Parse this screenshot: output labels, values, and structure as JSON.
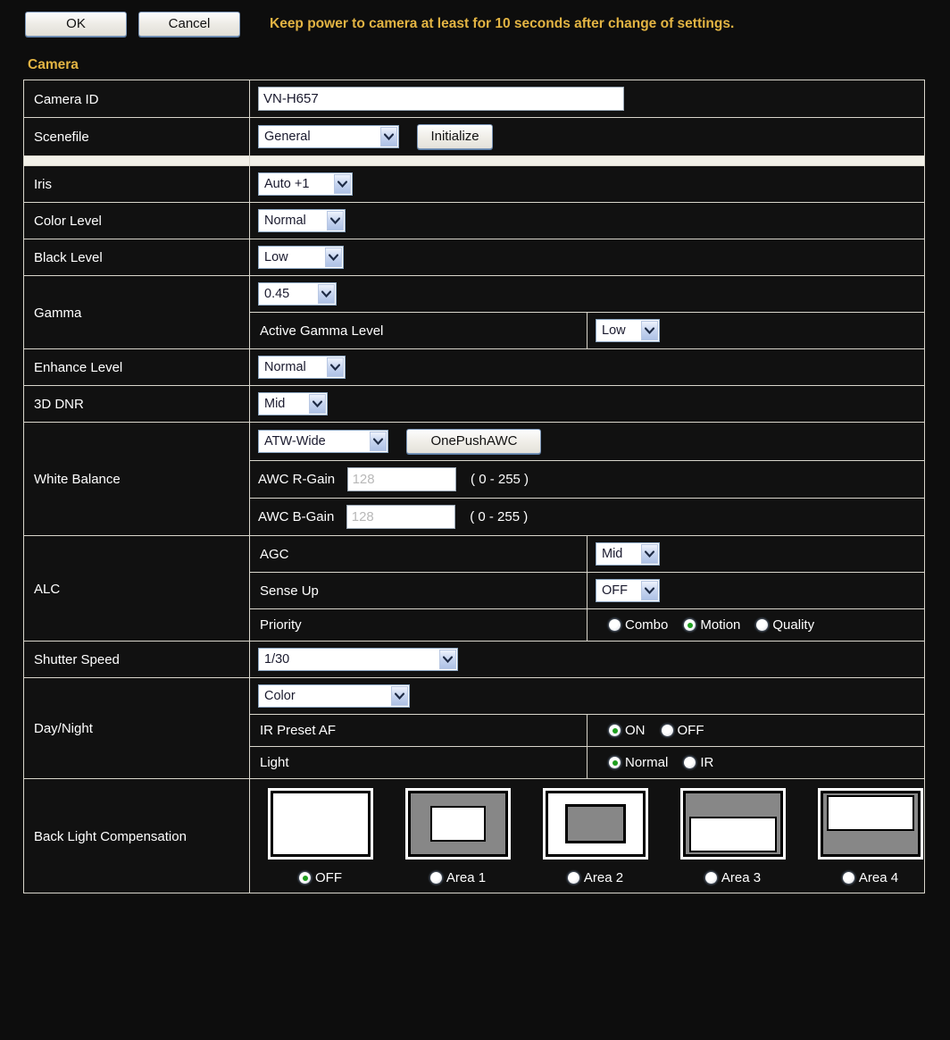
{
  "toolbar": {
    "ok_label": "OK",
    "cancel_label": "Cancel",
    "warning_text": "Keep power to camera at least for 10 seconds after change of settings."
  },
  "section": {
    "heading": "Camera"
  },
  "colors": {
    "accent": "#e3b443",
    "background": "#0d0d0d",
    "border": "#d9d6cc",
    "radio_selected": "#1f9e1f"
  },
  "rows": {
    "camera_id": {
      "label": "Camera ID",
      "value": "VN-H657"
    },
    "scenefile": {
      "label": "Scenefile",
      "value": "General",
      "button": "Initialize"
    },
    "iris": {
      "label": "Iris",
      "value": "Auto +1"
    },
    "color_level": {
      "label": "Color Level",
      "value": "Normal"
    },
    "black_level": {
      "label": "Black Level",
      "value": "Low"
    },
    "gamma": {
      "label": "Gamma",
      "value": "0.45",
      "active_gamma_label": "Active Gamma Level",
      "active_gamma_value": "Low"
    },
    "enhance_level": {
      "label": "Enhance Level",
      "value": "Normal"
    },
    "dnr_3d": {
      "label": "3D DNR",
      "value": "Mid"
    },
    "white_balance": {
      "label": "White Balance",
      "value": "ATW-Wide",
      "button": "OnePushAWC",
      "r_gain_label": "AWC R-Gain",
      "r_gain_value": "128",
      "r_gain_range": "( 0 - 255 )",
      "b_gain_label": "AWC B-Gain",
      "b_gain_value": "128",
      "b_gain_range": "( 0 - 255 )"
    },
    "alc": {
      "label": "ALC",
      "agc_label": "AGC",
      "agc_value": "Mid",
      "sense_up_label": "Sense Up",
      "sense_up_value": "OFF",
      "priority_label": "Priority",
      "priority_options": [
        "Combo",
        "Motion",
        "Quality"
      ],
      "priority_selected": "Motion"
    },
    "shutter_speed": {
      "label": "Shutter Speed",
      "value": "1/30"
    },
    "day_night": {
      "label": "Day/Night",
      "value": "Color",
      "ir_preset_label": "IR Preset AF",
      "ir_preset_options": [
        "ON",
        "OFF"
      ],
      "ir_preset_selected": "ON",
      "light_label": "Light",
      "light_options": [
        "Normal",
        "IR"
      ],
      "light_selected": "Normal"
    },
    "back_light_compensation": {
      "label": "Back Light Compensation",
      "selected": "OFF",
      "options": [
        {
          "label": "OFF",
          "variant": "v-off"
        },
        {
          "label": "Area 1",
          "variant": "v-a1"
        },
        {
          "label": "Area 2",
          "variant": "v-a2"
        },
        {
          "label": "Area 3",
          "variant": "v-a3"
        },
        {
          "label": "Area 4",
          "variant": "v-a4"
        }
      ]
    }
  }
}
